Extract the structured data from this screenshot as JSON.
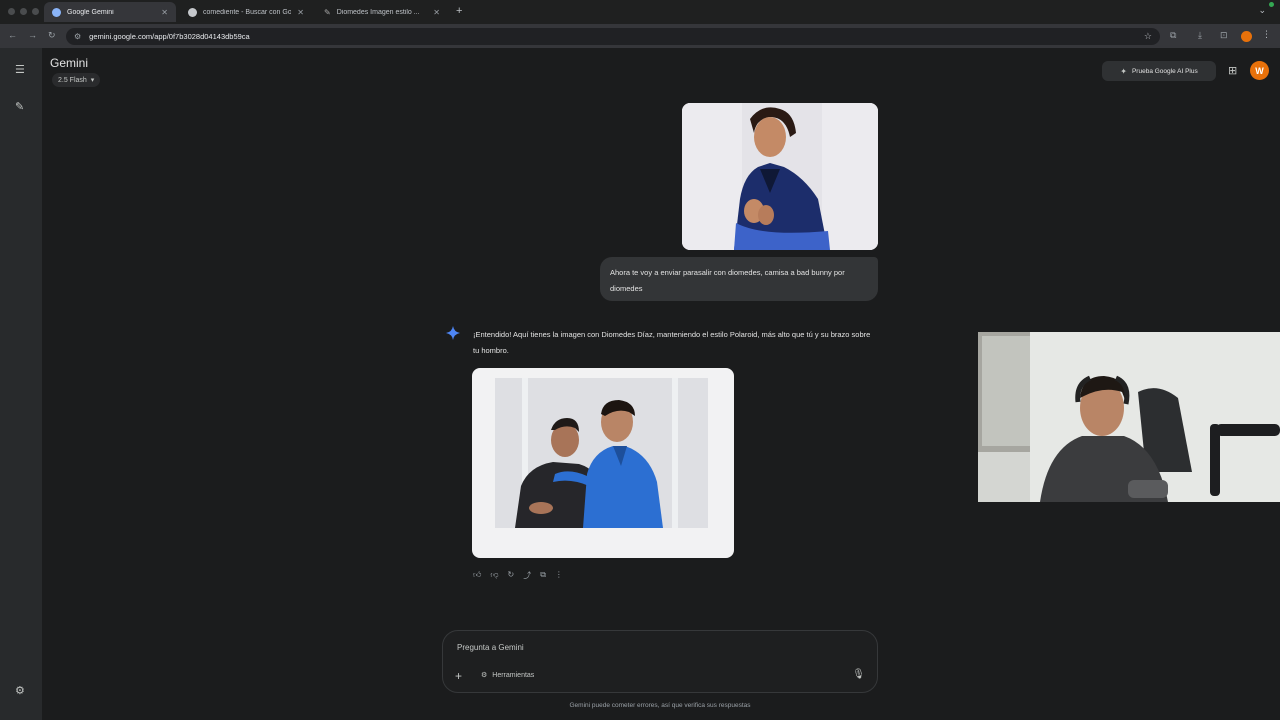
{
  "browser": {
    "tabs": [
      {
        "title": "Google Gemini",
        "active": true
      },
      {
        "title": "comediente - Buscar con Goo",
        "active": false
      },
      {
        "title": "Diomedes Imagen estilo ...",
        "active": false
      }
    ],
    "url": "gemini.google.com/app/0f7b3028d04143db59ca"
  },
  "app": {
    "title": "Gemini",
    "model": "2.5 Flash",
    "upgrade_label": "Prueba Google AI Plus",
    "user_initial": "W"
  },
  "conversation": {
    "user_message": "Ahora te voy a enviar parasalir con diomedes, camisa a bad bunny por diomedes",
    "model_message": "¡Entendido! Aquí tienes la imagen con Diomedes Díaz, manteniendo el estilo Polaroid, más alto que tú y su brazo sobre tu hombro."
  },
  "input": {
    "placeholder": "Pregunta a Gemini",
    "tools_label": "Herramientas",
    "disclaimer": "Gemini puede cometer errores, así que verifica sus respuestas"
  },
  "colors": {
    "accent": "#8ab4f8",
    "avatar": "#e8710a",
    "background": "#1b1c1d"
  },
  "icons": [
    "menu-icon",
    "new-chat-icon",
    "settings-icon",
    "spark-icon",
    "apps-icon",
    "thumbs-up-icon",
    "thumbs-down-icon",
    "regenerate-icon",
    "share-icon",
    "copy-icon",
    "more-icon",
    "plus-icon",
    "tools-icon",
    "mic-icon"
  ]
}
